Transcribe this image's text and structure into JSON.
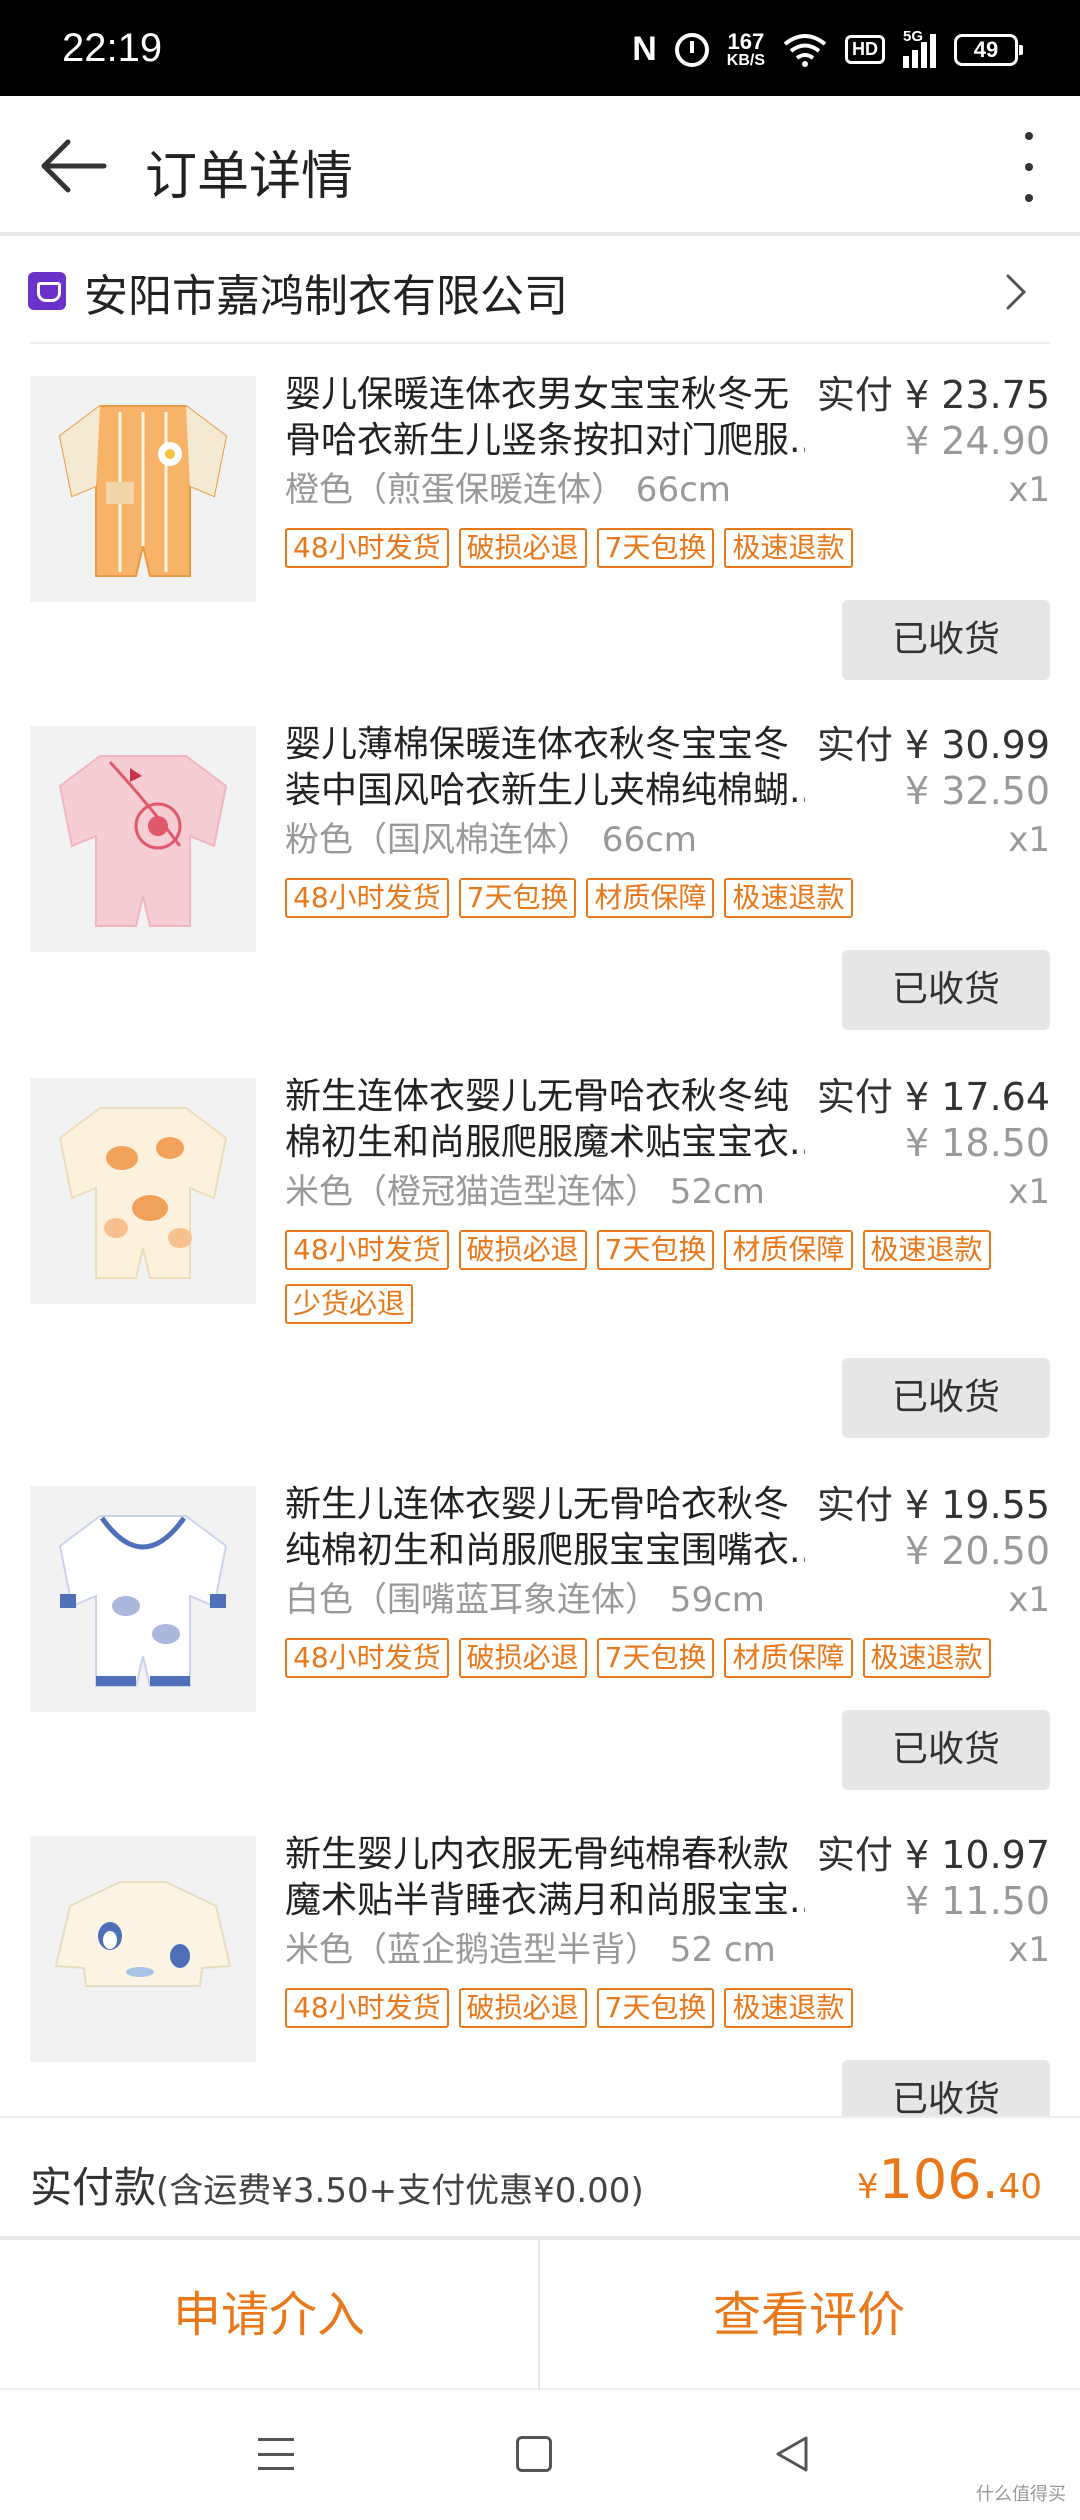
{
  "status_bar": {
    "time": "22:19",
    "nfc": "N",
    "speed_value": "167",
    "speed_unit": "KB/S",
    "hd": "HD",
    "network": "5G",
    "battery": "49"
  },
  "header": {
    "title": "订单详情"
  },
  "shop": {
    "name": "安阳市嘉鸿制衣有限公司"
  },
  "items": [
    {
      "title_line1": "婴儿保暖连体衣男女宝宝秋冬无",
      "title_line2": "骨哈衣新生儿竖条按扣对门爬服...",
      "paid": "实付 ¥ 23.75",
      "original": "¥ 24.90",
      "variant": "橙色（煎蛋保暖连体） 66cm",
      "qty": "x1",
      "tags": [
        "48小时发货",
        "破损必退",
        "7天包换",
        "极速退款"
      ],
      "button": "已收货",
      "color": "#f7b469"
    },
    {
      "title_line1": "婴儿薄棉保暖连体衣秋冬宝宝冬",
      "title_line2": "装中国风哈衣新生儿夹棉纯棉蝴...",
      "paid": "实付 ¥ 30.99",
      "original": "¥ 32.50",
      "variant": "粉色（国风棉连体） 66cm",
      "qty": "x1",
      "tags": [
        "48小时发货",
        "7天包换",
        "材质保障",
        "极速退款"
      ],
      "button": "已收货",
      "color": "#f7cdd4"
    },
    {
      "title_line1": "新生连体衣婴儿无骨哈衣秋冬纯",
      "title_line2": "棉初生和尚服爬服魔术贴宝宝衣...",
      "paid": "实付 ¥ 17.64",
      "original": "¥ 18.50",
      "variant": "米色（橙冠猫造型连体） 52cm",
      "qty": "x1",
      "tags": [
        "48小时发货",
        "破损必退",
        "7天包换",
        "材质保障",
        "极速退款",
        "少货必退"
      ],
      "button": "已收货",
      "color": "#fbf1dc"
    },
    {
      "title_line1": "新生儿连体衣婴儿无骨哈衣秋冬",
      "title_line2": "纯棉初生和尚服爬服宝宝围嘴衣...",
      "paid": "实付 ¥ 19.55",
      "original": "¥ 20.50",
      "variant": "白色（围嘴蓝耳象连体） 59cm",
      "qty": "x1",
      "tags": [
        "48小时发货",
        "破损必退",
        "7天包换",
        "材质保障",
        "极速退款"
      ],
      "button": "已收货",
      "color": "#ffffff"
    },
    {
      "title_line1": "新生婴儿内衣服无骨纯棉春秋款",
      "title_line2": "魔术贴半背睡衣满月和尚服宝宝...",
      "paid": "实付 ¥ 10.97",
      "original": "¥ 11.50",
      "variant": "米色（蓝企鹅造型半背） 52 cm",
      "qty": "x1",
      "tags": [
        "48小时发货",
        "破损必退",
        "7天包换",
        "极速退款"
      ],
      "button": "已收货",
      "color": "#fbf4e2"
    }
  ],
  "total": {
    "label": "实付款",
    "detail": "(含运费¥3.50+支付优惠¥0.00)",
    "currency": "¥",
    "amount_int": "106.",
    "amount_dec": "40"
  },
  "actions": {
    "left": "申请介入",
    "right": "查看评价"
  },
  "watermark": "什么值得买"
}
